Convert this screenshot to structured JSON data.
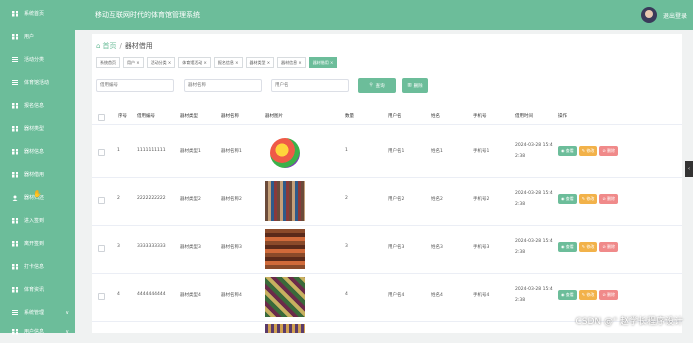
{
  "header": {
    "title": "移动互联网时代的体育馆管理系统",
    "logout": "退出登录"
  },
  "sidebar": {
    "items": [
      {
        "label": "系统首页",
        "chevron": ""
      },
      {
        "label": "用户",
        "chevron": ""
      },
      {
        "label": "活动分类",
        "chevron": ""
      },
      {
        "label": "体育馆活动",
        "chevron": ""
      },
      {
        "label": "报名信息",
        "chevron": ""
      },
      {
        "label": "器材类型",
        "chevron": ""
      },
      {
        "label": "器材信息",
        "chevron": ""
      },
      {
        "label": "器材借用",
        "chevron": ""
      },
      {
        "label": "器材归还",
        "chevron": ""
      },
      {
        "label": "进入签到",
        "chevron": ""
      },
      {
        "label": "离开签到",
        "chevron": ""
      },
      {
        "label": "打卡信息",
        "chevron": ""
      },
      {
        "label": "体育资讯",
        "chevron": ""
      },
      {
        "label": "系统管理",
        "chevron": "∨"
      },
      {
        "label": "用户信息",
        "chevron": "∨"
      }
    ]
  },
  "breadcrumb": {
    "home": "首页",
    "sep": "/",
    "current": "器材借用"
  },
  "tags": [
    "系统首页",
    "用户 ×",
    "活动分类 ×",
    "体育馆活动 ×",
    "报名信息 ×",
    "器材类型 ×",
    "器材信息 ×",
    "器材借用 ×"
  ],
  "search": {
    "placeholder1": "借用编号",
    "placeholder2": "器材名称",
    "placeholder3": "用户名",
    "search_label": "查询",
    "delete_label": "删除"
  },
  "table": {
    "headers": [
      "序号",
      "借用编号",
      "器材类型",
      "器材名称",
      "器材图片",
      "数量",
      "用户名",
      "姓名",
      "手机号",
      "借用时间",
      "操作"
    ],
    "rows": [
      {
        "idx": "1",
        "code": "1111111111",
        "type": "器材类型1",
        "name": "器材名称1",
        "qty": "1",
        "user": "用户名1",
        "realname": "姓名1",
        "phone": "手机号1",
        "date": "2024-03-28 15:4",
        "time": "2:38"
      },
      {
        "idx": "2",
        "code": "2222222222",
        "type": "器材类型2",
        "name": "器材名称2",
        "qty": "2",
        "user": "用户名2",
        "realname": "姓名2",
        "phone": "手机号2",
        "date": "2024-03-28 15:4",
        "time": "2:38"
      },
      {
        "idx": "3",
        "code": "3333333333",
        "type": "器材类型3",
        "name": "器材名称3",
        "qty": "3",
        "user": "用户名3",
        "realname": "姓名3",
        "phone": "手机号3",
        "date": "2024-03-28 15:4",
        "time": "2:38"
      },
      {
        "idx": "4",
        "code": "4444444444",
        "type": "器材类型4",
        "name": "器材名称4",
        "qty": "4",
        "user": "用户名4",
        "realname": "姓名4",
        "phone": "手机号4",
        "date": "2024-03-28 15:4",
        "time": "2:38"
      }
    ],
    "ops": {
      "view": "◉ 查看",
      "edit": "✎ 修改",
      "delete": "⊘ 删除"
    }
  },
  "watermark": "CSDN @\" 赵学长程序设计",
  "colors": {
    "accent": "#6cbd9a",
    "edit": "#f2b24a",
    "delete": "#f08a8a"
  }
}
